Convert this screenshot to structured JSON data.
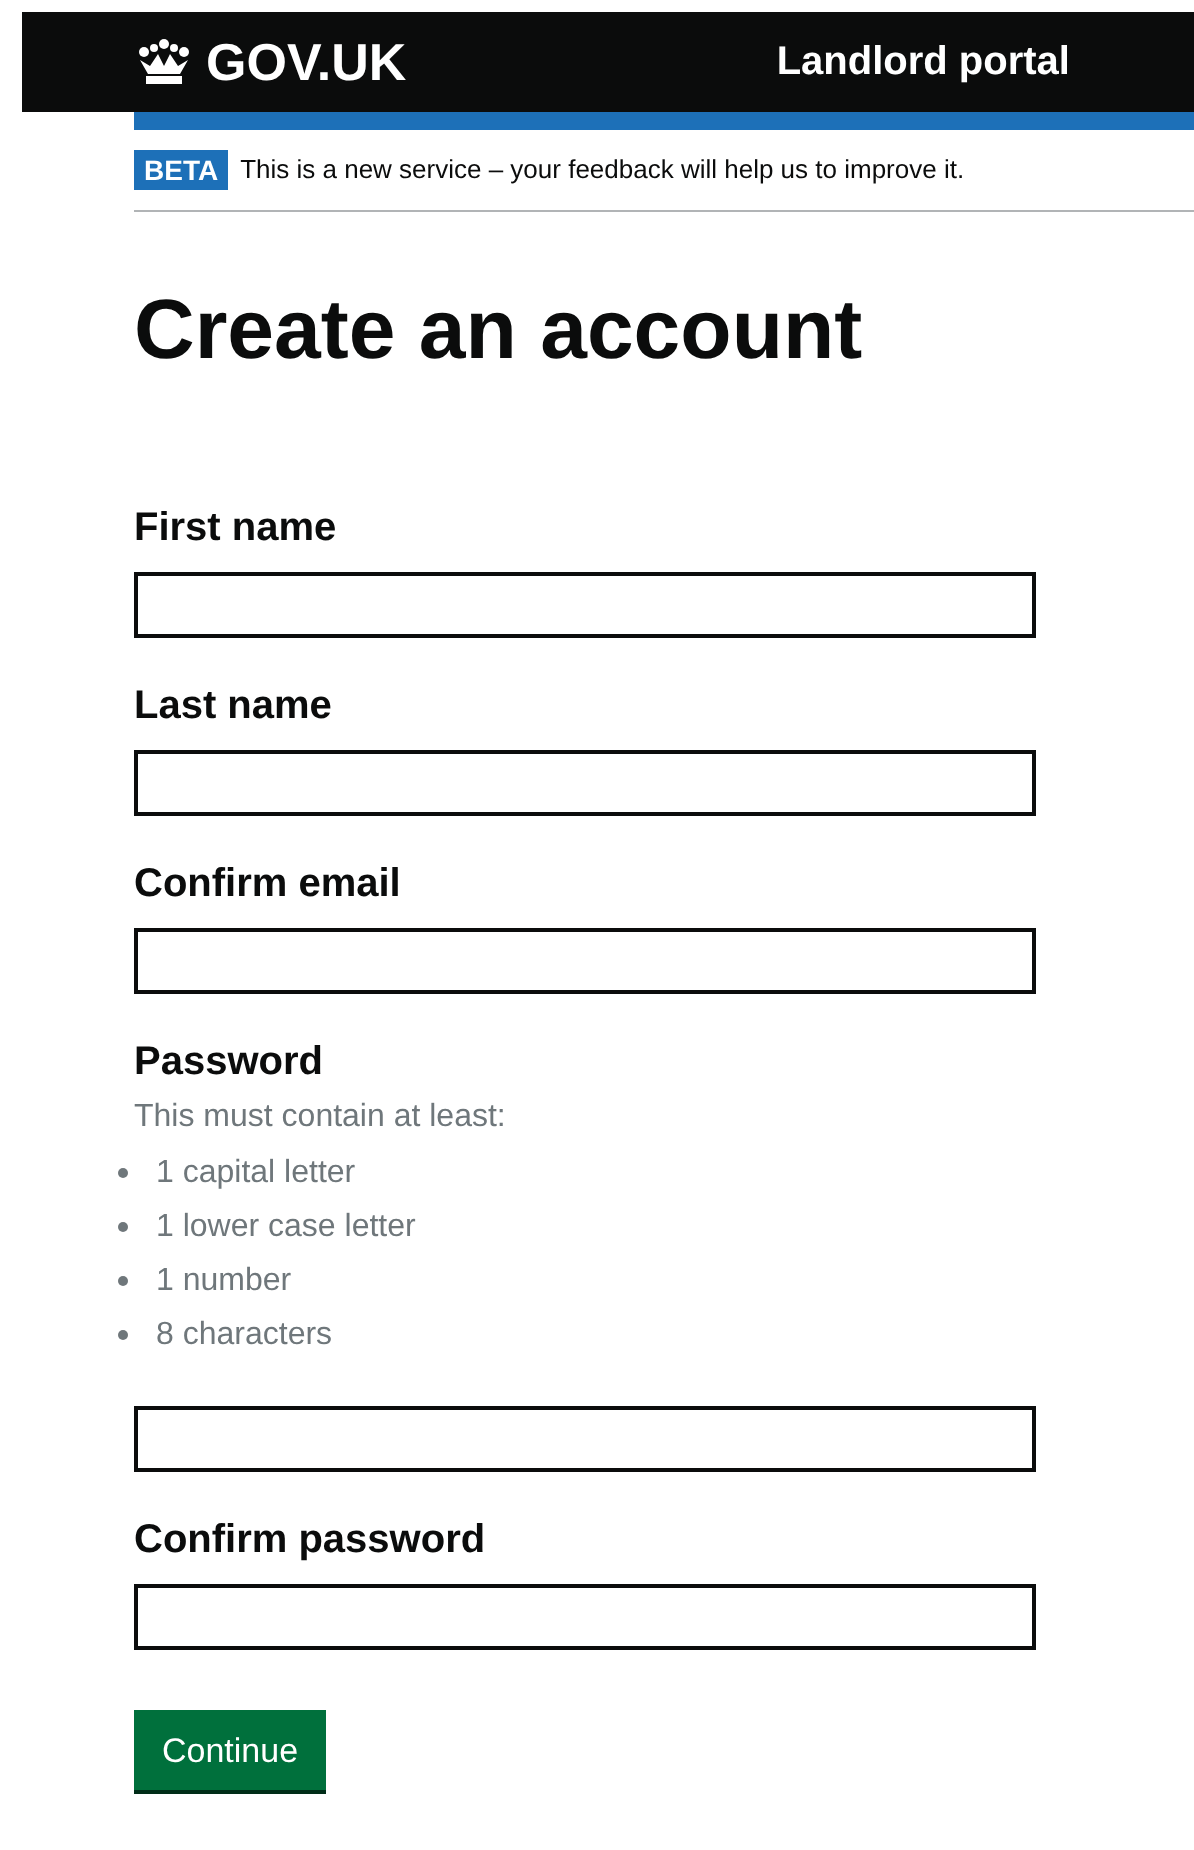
{
  "header": {
    "logo": "GOV.UK",
    "service_name": "Landlord portal"
  },
  "phase_banner": {
    "tag": "BETA",
    "text": "This is a new service – your feedback will help us to improve it."
  },
  "title": "Create an account",
  "fields": [
    {
      "label": "First name"
    },
    {
      "label": "Last name"
    },
    {
      "label": "Confirm email"
    },
    {
      "label": "Password",
      "hint": "This must contain at least:",
      "rules": [
        "1 capital letter",
        "1 lower case letter",
        "1 number",
        "8 characters"
      ]
    },
    {
      "label": "Confirm password"
    }
  ],
  "button": "Continue"
}
